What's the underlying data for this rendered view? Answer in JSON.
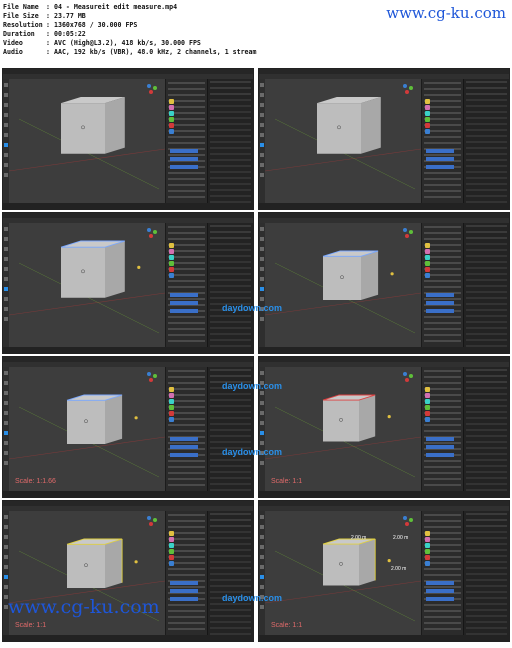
{
  "header": {
    "rows": [
      {
        "key": "File Name",
        "value": "04 - Measureit edit measure.mp4"
      },
      {
        "key": "File Size",
        "value": "23.77 MB"
      },
      {
        "key": "Resolution",
        "value": "1360x768 / 30.000 FPS"
      },
      {
        "key": "Duration",
        "value": "00:05:22"
      },
      {
        "key": "Video",
        "value": "AVC (High@L3.2), 418 kb/s, 30.000 FPS"
      },
      {
        "key": "Audio",
        "value": "AAC, 192 kb/s (VBR), 48.0 kHz, 2 channels, 1 stream"
      }
    ],
    "separator": ":",
    "watermark": "www.cg-ku.com"
  },
  "thumbnails": [
    {
      "scale_label": "",
      "dims": []
    },
    {
      "scale_label": "",
      "dims": []
    },
    {
      "scale_label": "",
      "dims": [],
      "stamp": ""
    },
    {
      "scale_label": "",
      "dims": [],
      "stamp": "daydown.com"
    },
    {
      "scale_label": "Scale: 1:1.66",
      "dims": [],
      "stamp": "daydown.com"
    },
    {
      "scale_label": "Scale: 1:1",
      "dims": [],
      "stamp": "daydown.com"
    },
    {
      "scale_label": "Scale: 1:1",
      "dims": [],
      "stamp": ""
    },
    {
      "scale_label": "Scale: 1:1",
      "dims": [
        "2.00 m",
        "2.00 m",
        "2.00 m"
      ],
      "stamp": "daydown.com"
    }
  ],
  "footer": {
    "watermark": "www.cg-ku.com"
  },
  "colors": {
    "viewport_bg": "#3d3d3d",
    "cube_top": "#c9c9c9",
    "cube_front": "#bdbdbd",
    "cube_side": "#a8a8a8",
    "scale_text": "#e06a6a",
    "dim_text": "#ffffff",
    "accent_blue": "#2a8fe8",
    "watermark_blue": "#1e56d8"
  }
}
